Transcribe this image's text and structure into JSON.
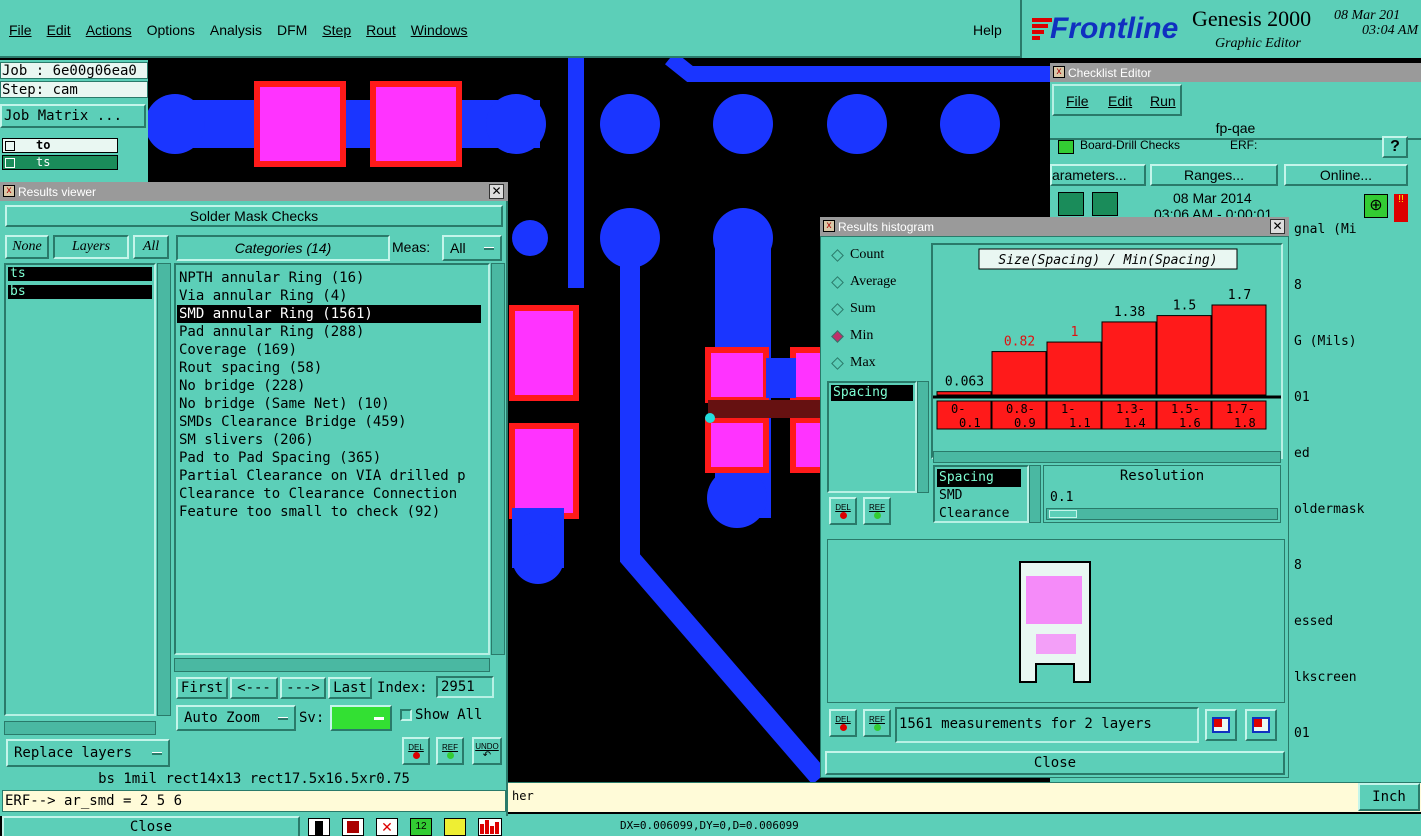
{
  "menubar": {
    "items": [
      "File",
      "Edit",
      "Actions",
      "Options",
      "Analysis",
      "DFM",
      "Step",
      "Rout",
      "Windows"
    ],
    "help": "Help"
  },
  "brand": {
    "logo": "Frontline",
    "product": "Genesis 2000",
    "subtitle": "Graphic Editor",
    "date": "08 Mar 201",
    "time": "03:04 AM"
  },
  "leftpanel": {
    "job": "Job : 6e00g06ea0",
    "step": "Step: cam",
    "job_matrix": "Job Matrix ...",
    "layers": [
      "to",
      "ts"
    ]
  },
  "results_viewer": {
    "title": "Results viewer",
    "heading": "Solder Mask Checks",
    "none": "None",
    "layers": "Layers",
    "all": "All",
    "categories_header": "Categories (14)",
    "meas_label": "Meas:",
    "meas_value": "All",
    "layer_list": [
      "ts",
      "bs"
    ],
    "categories": [
      "NPTH annular Ring (16)",
      "Via annular Ring (4)",
      "SMD annular Ring (1561)",
      "Pad annular Ring (288)",
      "Coverage (169)",
      "Rout spacing (58)",
      "No bridge (228)",
      "No bridge (Same Net) (10)",
      "SMDs Clearance Bridge (459)",
      "SM slivers (206)",
      "Pad to Pad Spacing (365)",
      "Partial Clearance on VIA drilled p",
      "Clearance to Clearance Connection",
      "Feature too small to check (92)"
    ],
    "selected_index": 2,
    "first": "First",
    "prev": "<---",
    "next": "--->",
    "last": "Last",
    "index_label": "Index:",
    "index_value": "2951",
    "auto_zoom": "Auto Zoom",
    "sv_label": "Sv:",
    "show_all": "Show All",
    "replace_layers": "Replace layers",
    "del": "DEL",
    "ref": "REF",
    "undo": "UNDO",
    "status": "bs 1mil   rect14x13   rect17.5x16.5xr0.75",
    "erf": "ERF--> ar_smd = 2 5 6",
    "close": "Close"
  },
  "histogram": {
    "title": "Results histogram",
    "options": [
      "Count",
      "Average",
      "Sum",
      "Min",
      "Max"
    ],
    "selected_option": "Min",
    "chart_title": "Size(Spacing) / Min(Spacing)",
    "measure_list": [
      "Spacing"
    ],
    "class_list": [
      "Spacing",
      "SMD",
      "Clearance"
    ],
    "resolution_label": "Resolution",
    "resolution_value": "0.1",
    "del": "DEL",
    "ref": "REF",
    "summary": "1561 measurements for 2 layers",
    "close": "Close"
  },
  "chart_data": {
    "type": "bar",
    "title": "Size(Spacing) / Min(Spacing)",
    "categories": [
      "0-0.1",
      "0.8-0.9",
      "1-1.1",
      "1.3-1.4",
      "1.5-1.6",
      "1.7-1.8"
    ],
    "values": [
      0.063,
      0.82,
      1,
      1.38,
      1.5,
      1.7
    ],
    "value_labels": [
      "0.063",
      "0.82",
      "1",
      "1.38",
      "1.5",
      "1.7"
    ],
    "bin_labels_top": [
      "0-",
      "0.8-",
      "1-",
      "1.3-",
      "1.5-",
      "1.7-"
    ],
    "bin_labels_bottom": [
      "0.1",
      "0.9",
      "1.1",
      "1.4",
      "1.6",
      "1.8"
    ],
    "ylim": [
      0,
      1.7
    ],
    "bar_color": "#ff1a1a"
  },
  "checklist": {
    "title": "Checklist Editor",
    "menu": [
      "File",
      "Edit",
      "Run"
    ],
    "name": "fp-qae",
    "row1_label": "Board-Drill Checks",
    "row1_erf": "ERF:",
    "parameters": "arameters...",
    "ranges": "Ranges...",
    "online": "Online...",
    "date": "08 Mar 2014",
    "time": "03:06 AM - 0:00:01",
    "rows": [
      "gnal (Mi",
      "8",
      "G (Mils)",
      "01",
      "ed",
      "oldermask",
      "8",
      "essed",
      "lkscreen",
      "01"
    ]
  },
  "bottombar": {
    "partial": "her",
    "inch": "Inch",
    "coords": "DX=0.006099,DY=0,D=0.006099"
  }
}
